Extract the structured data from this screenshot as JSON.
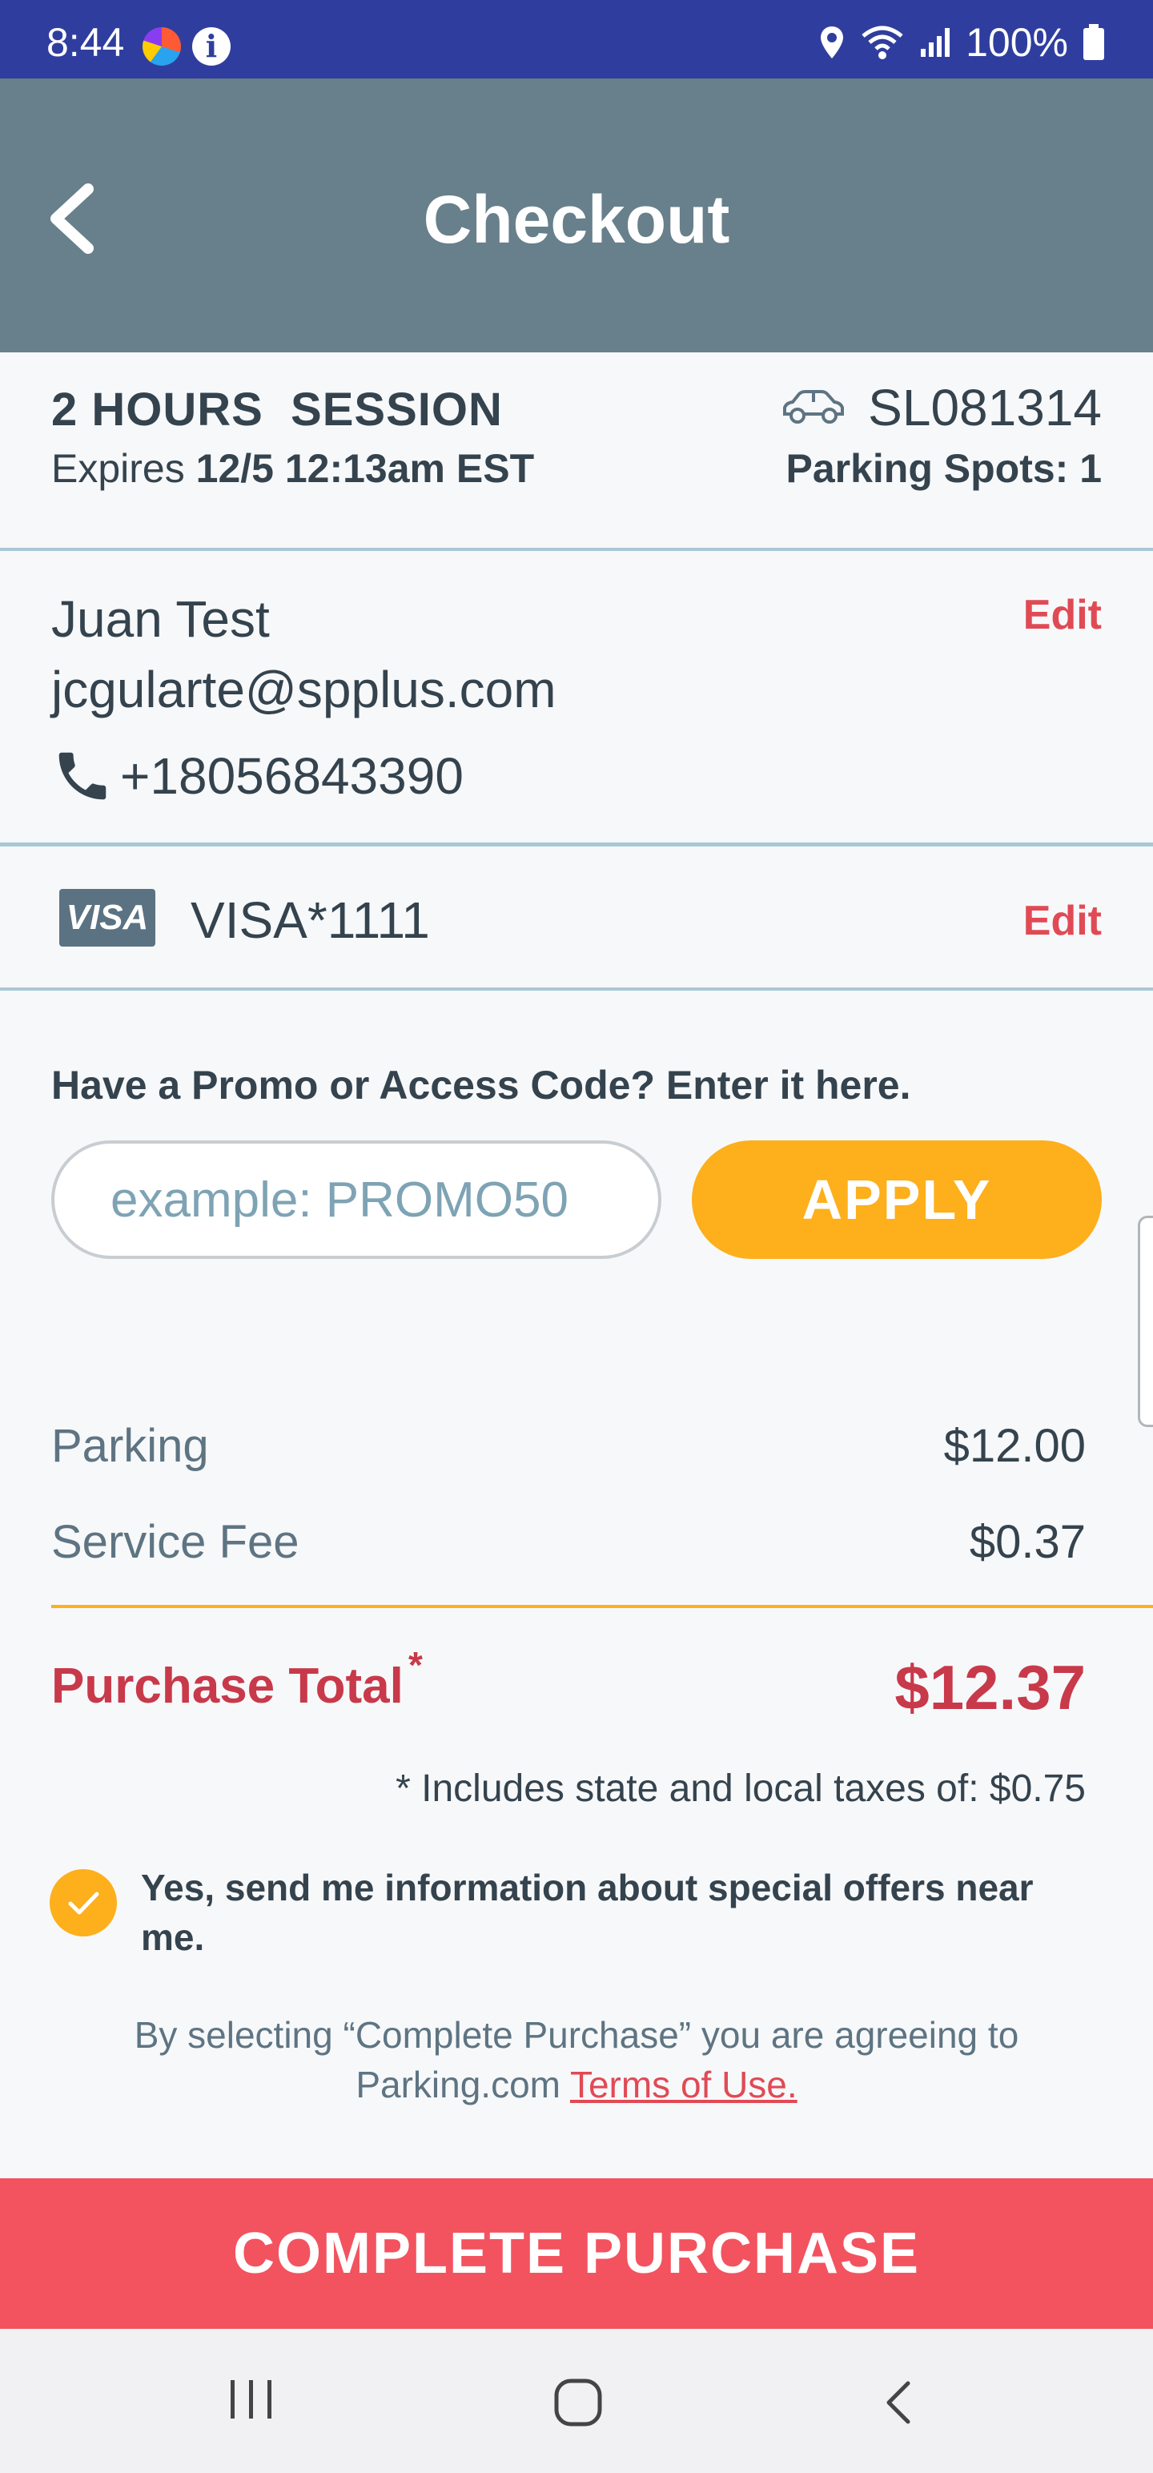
{
  "status_bar": {
    "time": "8:44",
    "battery": "100%"
  },
  "header": {
    "title": "Checkout"
  },
  "session": {
    "title": "2 HOURS  SESSION",
    "expires_label": "Expires",
    "expires_value": "12/5 12:13am EST",
    "plate": "SL081314",
    "parking_spots": "Parking Spots: 1"
  },
  "contact": {
    "name": "Juan Test",
    "email": "jcgularte@spplus.com",
    "phone": "+18056843390",
    "edit_label": "Edit"
  },
  "payment": {
    "card_brand": "VISA",
    "card": "VISA*1111",
    "edit_label": "Edit"
  },
  "promo": {
    "label": "Have a Promo or Access Code? Enter it here.",
    "placeholder": "example: PROMO50",
    "apply_label": "APPLY"
  },
  "pricing": {
    "items": [
      {
        "label": "Parking",
        "value": "$12.00"
      },
      {
        "label": "Service Fee",
        "value": "$0.37"
      }
    ],
    "total_label": "Purchase Total",
    "total_marker": "*",
    "total_value": "$12.37",
    "tax_note": "* Includes state and local taxes of: $0.75"
  },
  "offers": {
    "checked": true,
    "text": "Yes, send me information about special offers near me."
  },
  "terms": {
    "text": "By selecting “Complete Purchase” you are agreeing to Parking.com",
    "link": "Terms of Use."
  },
  "complete_label": "COMPLETE PURCHASE",
  "colors": {
    "status_bar": "#2f3e9e",
    "header": "#67808b",
    "accent_orange": "#fdaf1c",
    "accent_red": "#f2535f",
    "total_red": "#c8394a"
  }
}
